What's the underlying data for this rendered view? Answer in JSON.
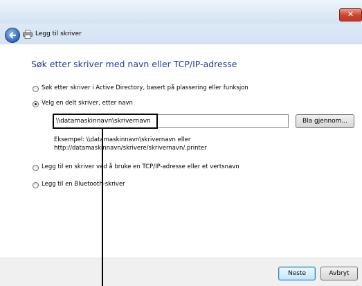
{
  "window": {
    "close_glyph": "✕",
    "title": "Legg til skriver"
  },
  "icons": {
    "back": "back-arrow-icon",
    "printer": "printer-icon",
    "close": "close-icon"
  },
  "page": {
    "heading": "Søk etter skriver med navn eller TCP/IP-adresse"
  },
  "options": [
    {
      "label": "Søk etter skriver i Active Directory, basert på plassering eller funksjon",
      "checked": false
    },
    {
      "label": "Velg en delt skriver, etter navn",
      "checked": true
    },
    {
      "label": "Legg til en skriver ved å bruke en TCP/IP-adresse eller et vertsnavn",
      "checked": false
    },
    {
      "label": "Legg til en Bluetooth-skriver",
      "checked": false
    }
  ],
  "shared_printer": {
    "value": "\\\\datamaskinnavn\\skrivernavn",
    "browse_label": "Bla gjennom...",
    "example_line1": "Eksempel: \\\\datamaskinnavn\\skrivernavn eller",
    "example_line2": "http://datamaskinnavn/skrivere/skrivernavn/.printer"
  },
  "footer": {
    "next_label": "Neste",
    "cancel_label": "Avbryt"
  },
  "colors": {
    "heading": "#1e3c9a",
    "close_button": "#c8432e",
    "titlebar": "#dde9f6"
  }
}
